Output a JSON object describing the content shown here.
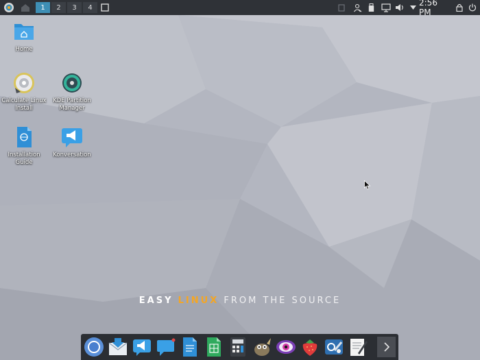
{
  "top_panel": {
    "desktops": [
      "1",
      "2",
      "3",
      "4"
    ],
    "active_desktop": "1",
    "clock": "2:56 PM"
  },
  "desktop_icons": [
    {
      "label": "Home"
    },
    {
      "label": "Calculate Linux Install"
    },
    {
      "label": "KDE Partition Manager"
    },
    {
      "label": "Installation Guide"
    },
    {
      "label": "Konversation"
    }
  ],
  "tagline": {
    "part1": "EASY",
    "part2": "LINUX",
    "part3": "FROM THE SOURCE"
  },
  "colors": {
    "panel": "#2f3237",
    "active_desktop": "#3e8fb5",
    "tagline_accent": "#f5a623",
    "dock": "#2b2e33"
  },
  "dock_icons": [
    "chromium-icon",
    "mail-icon",
    "konversation-icon",
    "chat-icon",
    "document-icon",
    "spreadsheet-icon",
    "calculator-icon",
    "gimp-icon",
    "eye-icon",
    "strawberry-icon",
    "settings-icon",
    "text-editor-icon",
    "chevron-right-icon"
  ]
}
